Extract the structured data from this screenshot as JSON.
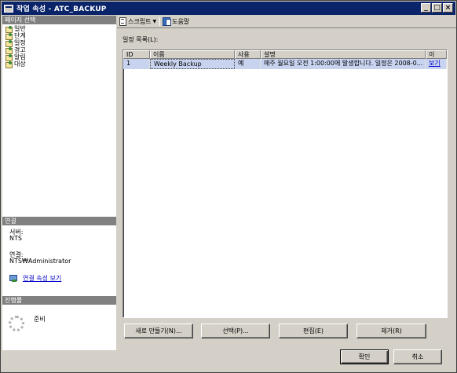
{
  "window": {
    "title": "작업 속성 - ATC_BACKUP",
    "controls": {
      "minimize": "_",
      "maximize": "□",
      "close": "×"
    }
  },
  "left_panel": {
    "pages_header": "페이지 선택",
    "pages": [
      "일반",
      "단계",
      "일정",
      "경고",
      "알림",
      "대상"
    ],
    "connection_header": "연결",
    "server_label": "서버:",
    "server_value": "NTS",
    "connection_label": "연결:",
    "connection_value": "NTS₩Administrator",
    "connection_link": "연결 속성 보기",
    "progress_header": "진행률",
    "progress_status": "준비"
  },
  "toolbar": {
    "script_label": "스크립트",
    "help_label": "도움말"
  },
  "main": {
    "schedule_list_label": "일정 목록(L):",
    "columns": [
      "ID",
      "이름",
      "사용",
      "설명",
      "이"
    ],
    "rows": [
      {
        "id": "1",
        "name": "Weekly Backup",
        "enabled": "예",
        "description": "매주 월요일 오전 1:00:00에 발생합니다. 일정은 2008-0...",
        "action": "보기"
      }
    ],
    "buttons": {
      "new": "새로 만들기(N)...",
      "select": "선택(P)...",
      "edit": "편집(E)",
      "remove": "제거(R)"
    }
  },
  "footer": {
    "ok": "확인",
    "cancel": "취소"
  },
  "icons": {
    "page": "page-settings-icon",
    "script": "script-icon",
    "help": "help-icon",
    "connection": "connection-properties-icon",
    "progress": "progress-spinner-icon"
  },
  "colors": {
    "title_bar": "#0a246a",
    "selected_row": "#c8d3f0",
    "section_header": "#808080",
    "link": "#0000cc"
  }
}
